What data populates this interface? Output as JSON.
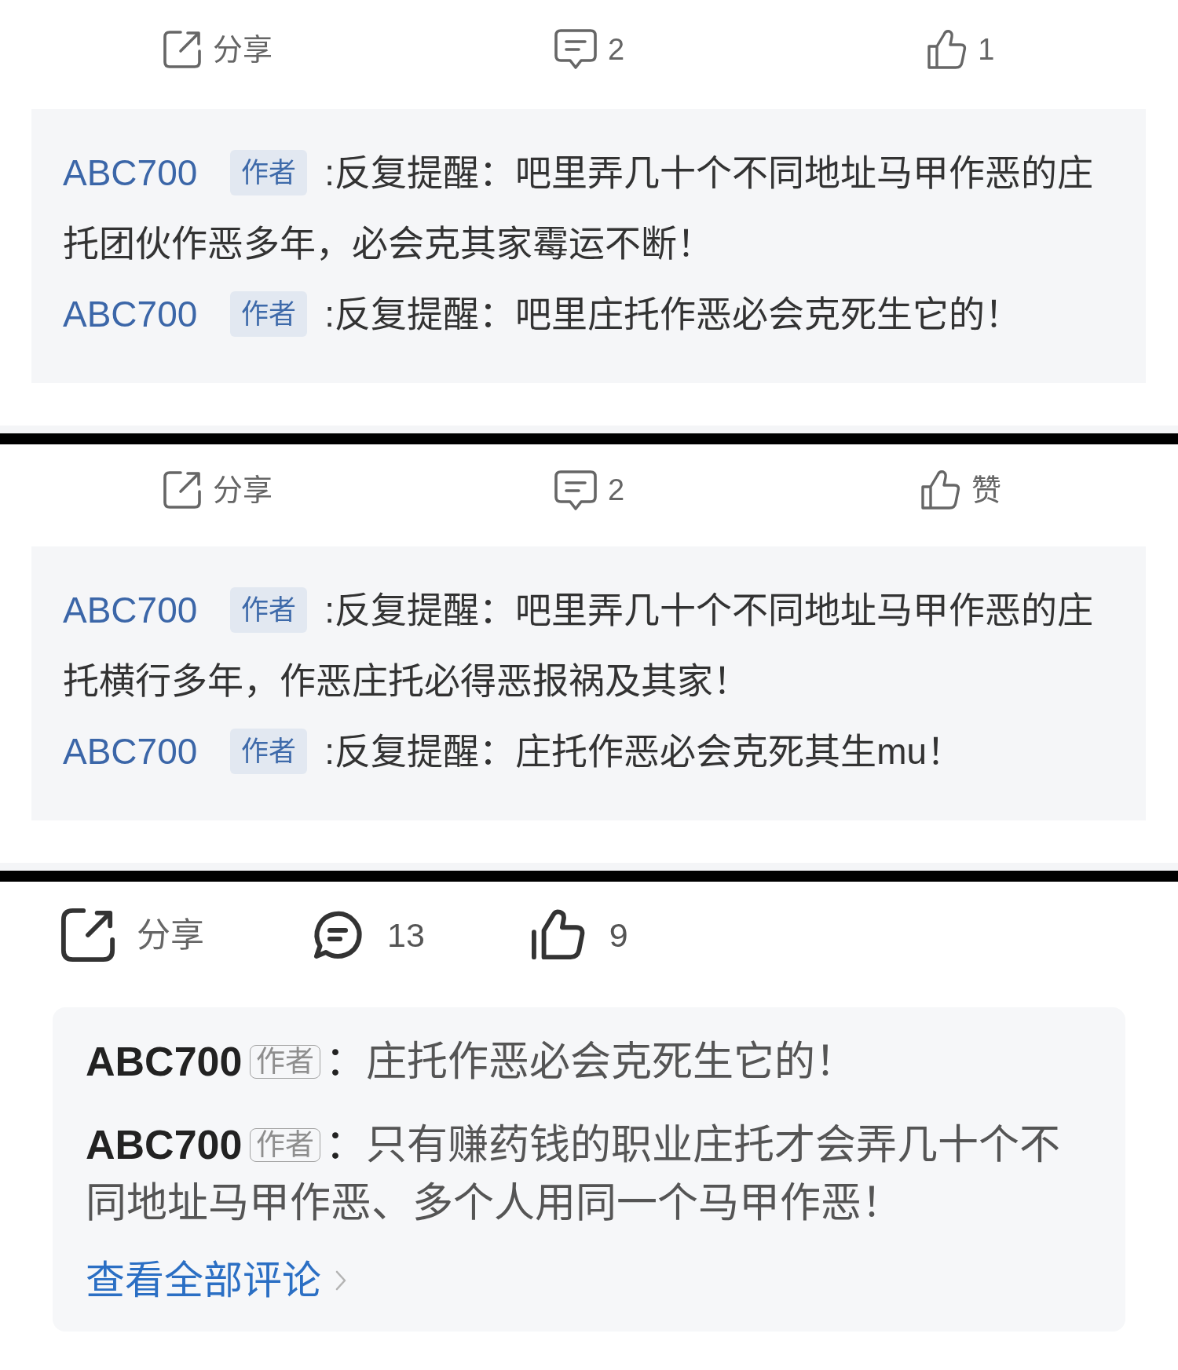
{
  "panels": [
    {
      "kind": "classic",
      "actions": [
        {
          "kind": "share",
          "label": "分享"
        },
        {
          "kind": "comment",
          "label": "2"
        },
        {
          "kind": "like",
          "label": "1"
        }
      ],
      "comments": [
        {
          "author": "ABC700",
          "badge": "作者",
          "separator": ":",
          "text": "反复提醒：吧里弄几十个不同地址马甲作恶的庄托团伙作恶多年，必会克其家霉运不断！"
        },
        {
          "author": "ABC700",
          "badge": "作者",
          "separator": ":",
          "text": "反复提醒：吧里庄托作恶必会克死生它的！"
        }
      ]
    },
    {
      "kind": "classic",
      "actions": [
        {
          "kind": "share",
          "label": "分享"
        },
        {
          "kind": "comment",
          "label": "2"
        },
        {
          "kind": "like",
          "label": "赞"
        }
      ],
      "comments": [
        {
          "author": "ABC700",
          "badge": "作者",
          "separator": ":",
          "text": "反复提醒：吧里弄几十个不同地址马甲作恶的庄托横行多年，作恶庄托必得恶报祸及其家！"
        },
        {
          "author": "ABC700",
          "badge": "作者",
          "separator": ":",
          "text": "反复提醒：庄托作恶必会克死其生mu！"
        }
      ]
    },
    {
      "kind": "modern",
      "actions": [
        {
          "kind": "share",
          "label": "分享"
        },
        {
          "kind": "comment",
          "label": "13"
        },
        {
          "kind": "like",
          "label": "9"
        }
      ],
      "comments": [
        {
          "author": "ABC700",
          "badge": "作者",
          "separator": "：",
          "text": "庄托作恶必会克死生它的！"
        },
        {
          "author": "ABC700",
          "badge": "作者",
          "separator": "：",
          "text": "只有赚药钱的职业庄托才会弄几十个不同地址马甲作恶、多个人用同一个马甲作恶！"
        }
      ],
      "view_all": {
        "label": "查看全部评论"
      }
    }
  ]
}
